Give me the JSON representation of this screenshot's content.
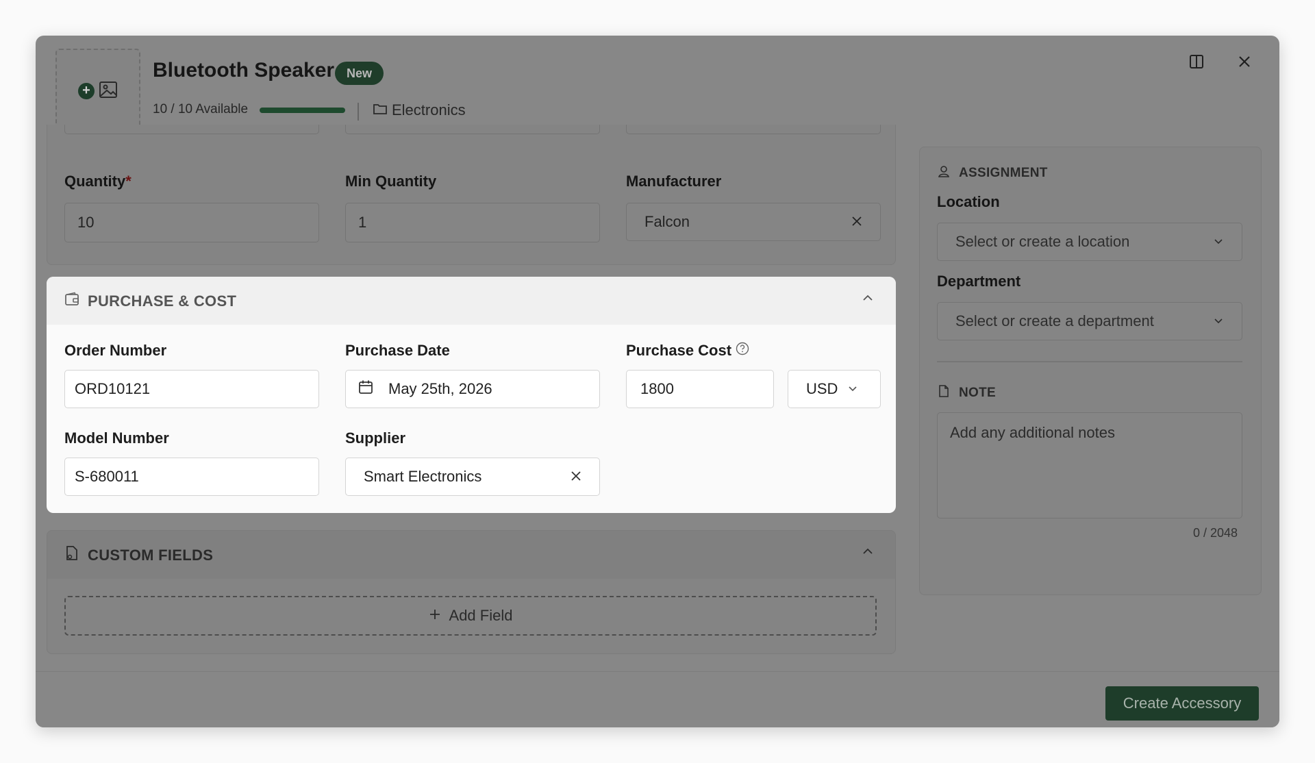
{
  "header": {
    "title": "Bluetooth Speaker",
    "badge": "New",
    "availability": "10 / 10 Available",
    "availability_fraction": 1.0,
    "category": "Electronics"
  },
  "inventory": {
    "quantity_label": "Quantity",
    "quantity_required": "*",
    "quantity_value": "10",
    "min_quantity_label": "Min Quantity",
    "min_quantity_value": "1",
    "manufacturer_label": "Manufacturer",
    "manufacturer_value": "Falcon"
  },
  "purchase": {
    "section_title": "PURCHASE & COST",
    "order_number_label": "Order Number",
    "order_number_value": "ORD10121",
    "purchase_date_label": "Purchase Date",
    "purchase_date_value": "May 25th, 2026",
    "purchase_cost_label": "Purchase Cost",
    "purchase_cost_value": "1800",
    "currency_value": "USD",
    "model_number_label": "Model Number",
    "model_number_value": "S-680011",
    "supplier_label": "Supplier",
    "supplier_value": "Smart Electronics"
  },
  "custom_fields": {
    "section_title": "CUSTOM FIELDS",
    "add_field_label": "Add Field"
  },
  "assignment": {
    "section_title": "ASSIGNMENT",
    "location_label": "Location",
    "location_placeholder": "Select or create a location",
    "department_label": "Department",
    "department_placeholder": "Select or create a department"
  },
  "note": {
    "section_title": "NOTE",
    "placeholder": "Add any additional notes",
    "counter": "0 / 2048"
  },
  "footer": {
    "create_label": "Create Accessory"
  },
  "colors": {
    "accent": "#1e3d2a",
    "overlay_bg": "#878787",
    "highlight_card": "#fafafa"
  }
}
